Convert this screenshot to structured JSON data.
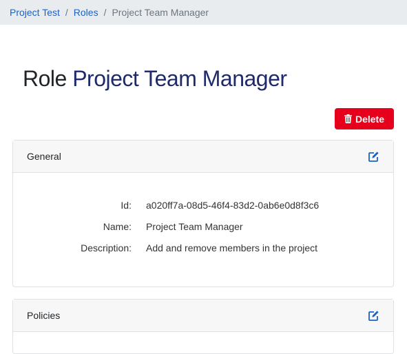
{
  "breadcrumb": {
    "items": [
      {
        "label": "Project Test"
      },
      {
        "label": "Roles"
      }
    ],
    "separator": "/",
    "current": "Project Team Manager"
  },
  "title": {
    "prefix": "Role",
    "name": "Project Team Manager"
  },
  "actions": {
    "delete_label": "Delete"
  },
  "general": {
    "header": "General",
    "fields": [
      {
        "label": "Id:",
        "value": "a020ff7a-08d5-46f4-83d2-0ab6e0d8f3c6"
      },
      {
        "label": "Name:",
        "value": "Project Team Manager"
      },
      {
        "label": "Description:",
        "value": "Add and remove members in the project"
      }
    ]
  },
  "policies": {
    "header": "Policies"
  },
  "colors": {
    "link": "#1a62c7",
    "title_name": "#1f2a6b",
    "danger": "#e6001c",
    "edit_icon": "#1a62c7"
  },
  "icons": {
    "delete": "trash-icon",
    "edit": "edit-icon"
  }
}
